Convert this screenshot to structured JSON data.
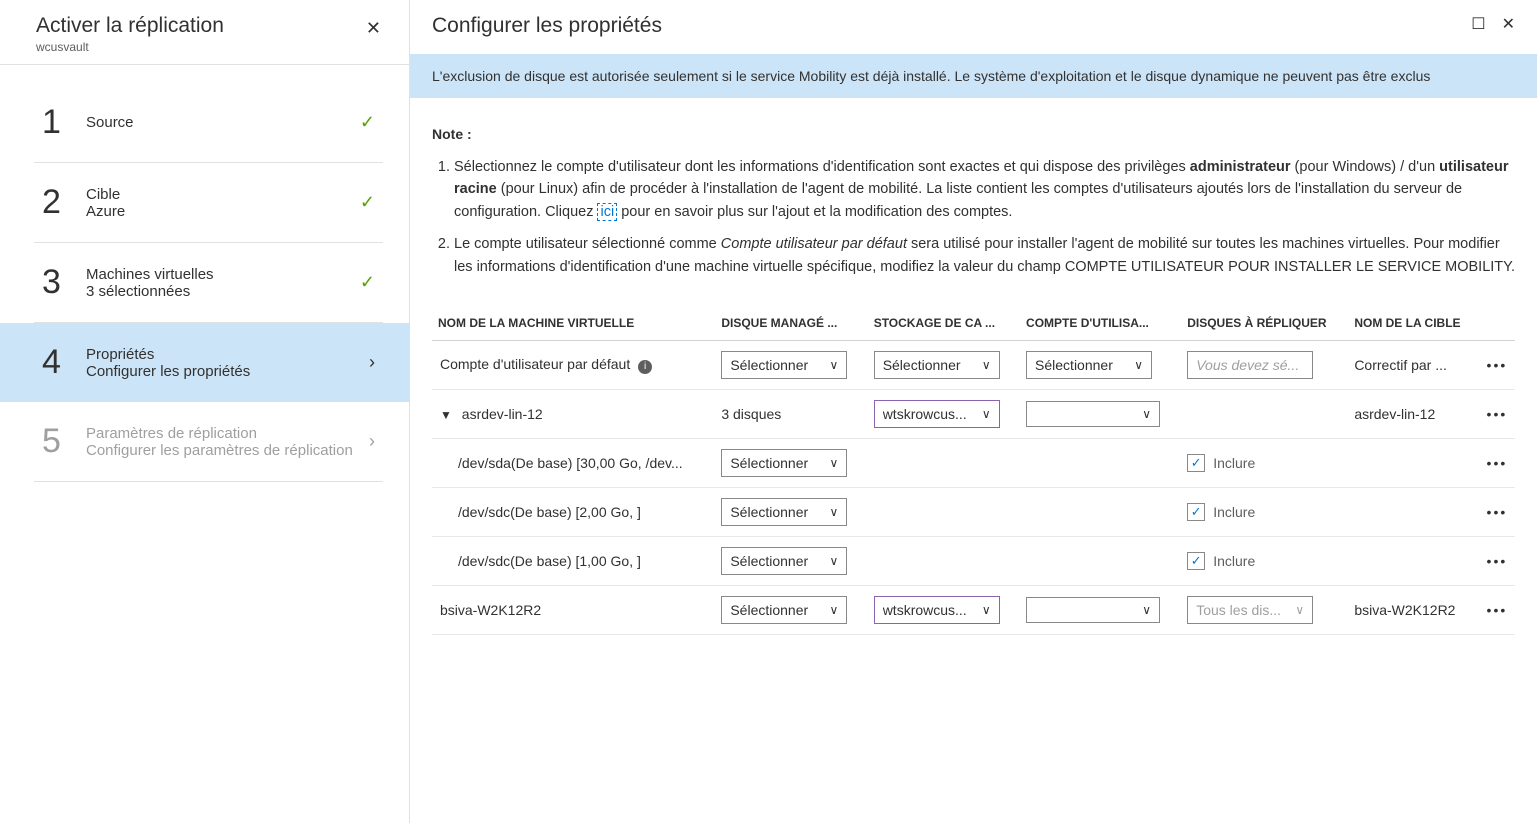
{
  "sidebar": {
    "title": "Activer la réplication",
    "subtitle": "wcusvault",
    "steps": [
      {
        "num": "1",
        "title": "Source",
        "sub": "",
        "status": "done"
      },
      {
        "num": "2",
        "title": "Cible",
        "sub": "Azure",
        "status": "done"
      },
      {
        "num": "3",
        "title": "Machines virtuelles",
        "sub": "3 sélectionnées",
        "status": "done"
      },
      {
        "num": "4",
        "title": "Propriétés",
        "sub": "Configurer les propriétés",
        "status": "active"
      },
      {
        "num": "5",
        "title": "Paramètres de réplication",
        "sub": "Configurer les paramètres de réplication",
        "status": "disabled"
      }
    ]
  },
  "main": {
    "title": "Configurer les propriétés",
    "banner": "L'exclusion de disque est autorisée seulement si le service Mobility est déjà installé. Le système d'exploitation et le disque dynamique ne peuvent pas être exclus",
    "note_label": "Note :",
    "note1_a": "Sélectionnez le compte d'utilisateur dont les informations d'identification sont exactes et qui dispose des privilèges ",
    "note1_b": "administrateur",
    "note1_c": " (pour Windows) / d'un ",
    "note1_d": "utilisateur racine",
    "note1_e": " (pour Linux) afin de procéder à l'installation de l'agent de mobilité. La liste contient les comptes d'utilisateurs ajoutés lors de l'installation du serveur de configuration. Cliquez ",
    "note1_link": "ici",
    "note1_f": " pour en savoir plus sur l'ajout et la modification des comptes.",
    "note2_a": "Le compte utilisateur sélectionné comme ",
    "note2_b": "Compte utilisateur par défaut",
    "note2_c": " sera utilisé pour installer l'agent de mobilité sur toutes les machines virtuelles. Pour modifier les informations d'identification d'une machine virtuelle spécifique, modifiez la valeur du champ COMPTE UTILISATEUR POUR INSTALLER LE SERVICE MOBILITY.",
    "columns": {
      "c1": "NOM DE LA MACHINE VIRTUELLE",
      "c2": "DISQUE MANAGÉ ...",
      "c3": "STOCKAGE DE CA ...",
      "c4": "COMPTE D'UTILISA...",
      "c5": "DISQUES À RÉPLIQUER",
      "c6": "NOM DE LA CIBLE"
    },
    "select_label": "Sélectionner",
    "include_label": "Inclure",
    "rows": {
      "r0": {
        "name": "Compte d'utilisateur par défaut",
        "disks_placeholder": "Vous devez sé...",
        "target": "Correctif par ..."
      },
      "r1": {
        "name": "asrdev-lin-12",
        "managed": "3 disques",
        "storage": "wtskrowcus...",
        "target": "asrdev-lin-12"
      },
      "r1a": {
        "name": "/dev/sda(De base) [30,00 Go, /dev..."
      },
      "r1b": {
        "name": "/dev/sdc(De base) [2,00 Go, ]"
      },
      "r1c": {
        "name": "/dev/sdc(De base) [1,00 Go, ]"
      },
      "r2": {
        "name": "bsiva-W2K12R2",
        "storage": "wtskrowcus...",
        "disks": "Tous les dis...",
        "target": "bsiva-W2K12R2"
      }
    }
  }
}
